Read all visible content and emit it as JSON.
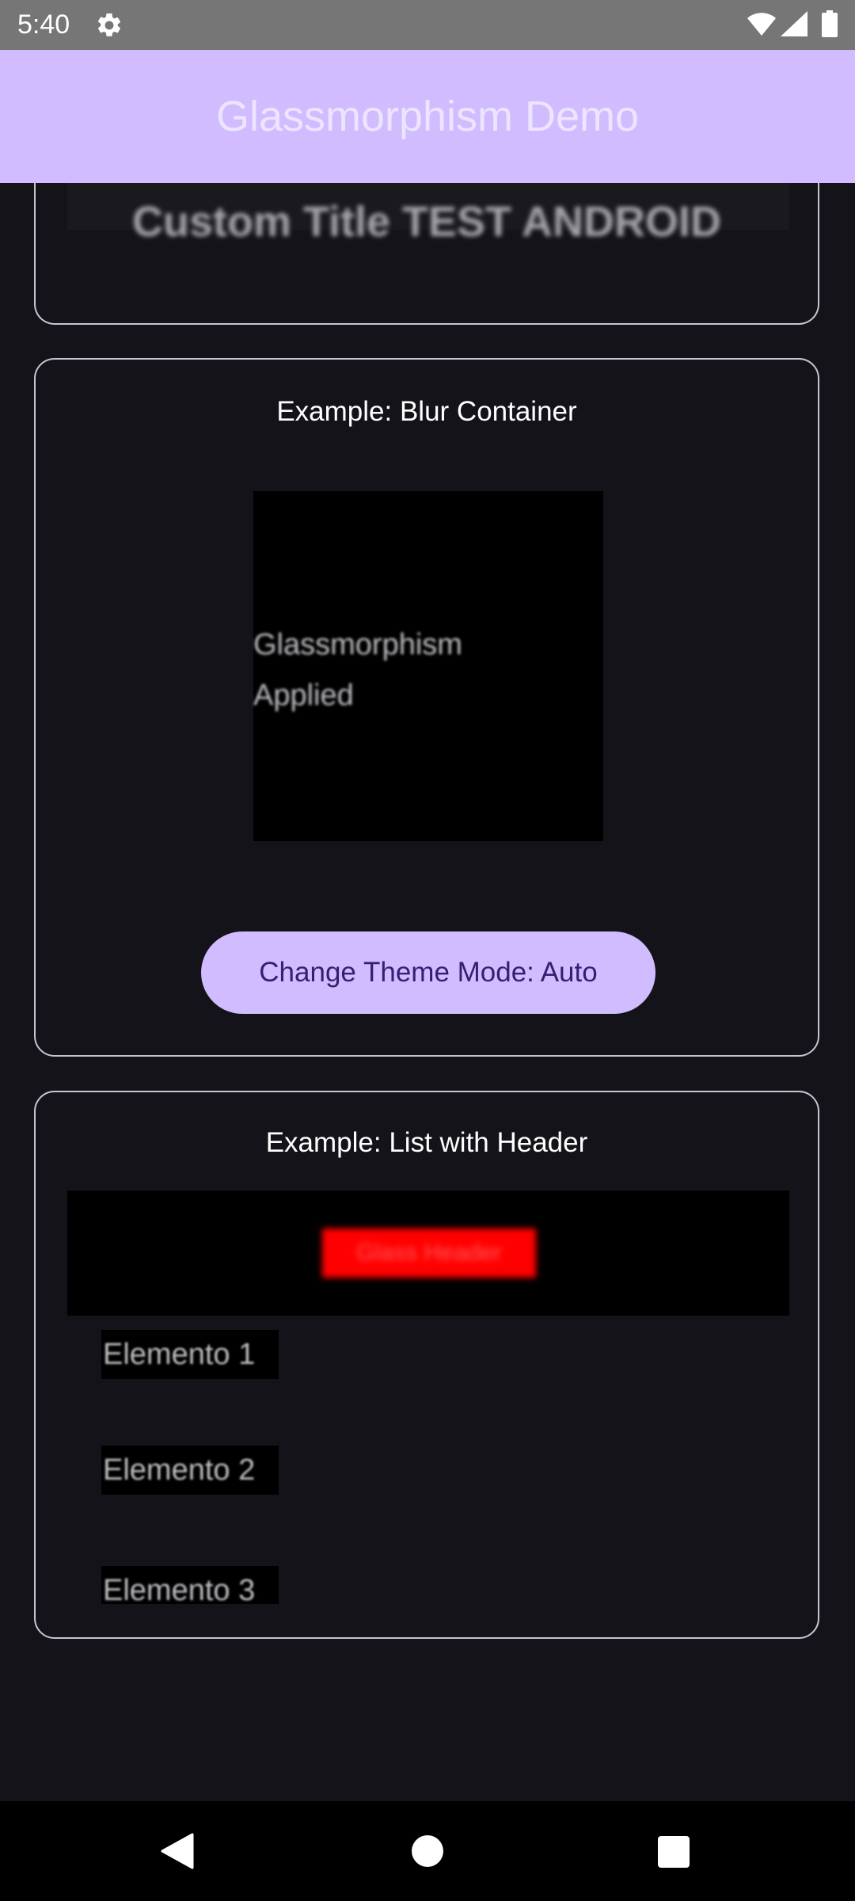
{
  "status_bar": {
    "time": "5:40",
    "icons": [
      "settings-gear-icon",
      "wifi-icon",
      "cell-signal-icon",
      "battery-icon"
    ]
  },
  "app_bar": {
    "title": "Glassmorphism Demo",
    "background": "#d0bcff"
  },
  "card_custom_title": {
    "title": "Custom Title TEST ANDROID"
  },
  "card_blur": {
    "heading": "Example: Blur Container",
    "blur_text": "Glassmorphism Applied",
    "button_label": "Change Theme Mode: Auto"
  },
  "card_list": {
    "heading": "Example: List with Header",
    "header_label": "Glass Header",
    "header_color": "#ff0000",
    "items": [
      {
        "label": "Elemento 1"
      },
      {
        "label": "Elemento 2"
      },
      {
        "label": "Elemento 3"
      }
    ]
  },
  "nav_bar": {
    "icons": [
      "back-icon",
      "home-icon",
      "recents-icon"
    ]
  },
  "colors": {
    "background": "#15131a",
    "accent": "#d0bcff",
    "button_text": "#381e72",
    "card_border": "#c8c5cf"
  }
}
